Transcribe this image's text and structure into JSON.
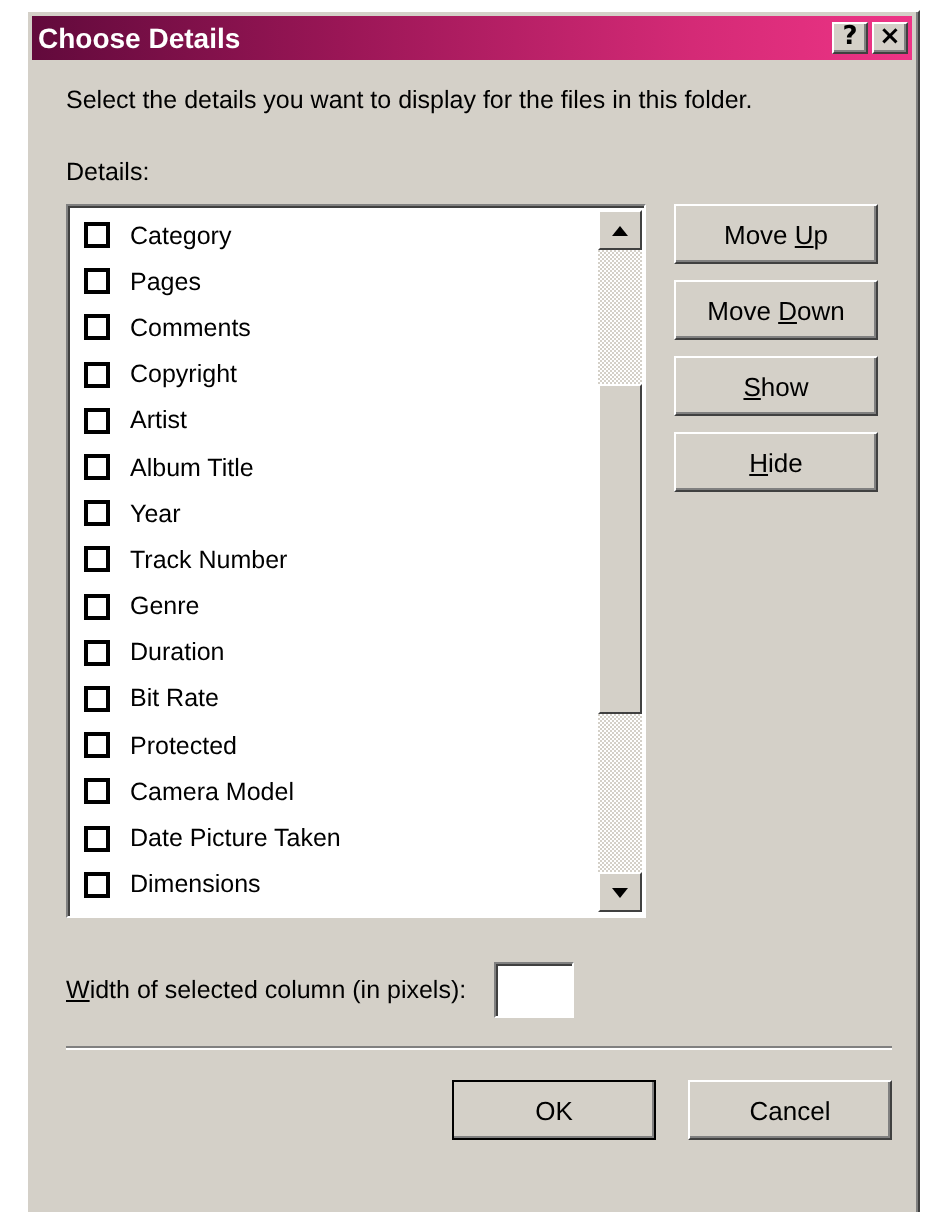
{
  "window": {
    "title": "Choose Details",
    "title_buttons": [
      "?",
      "×"
    ]
  },
  "instruction": "Select the details you want to display for the files in this folder.",
  "details_label": "Details:",
  "details": [
    {
      "label": "Category",
      "checked": false
    },
    {
      "label": "Pages",
      "checked": false
    },
    {
      "label": "Comments",
      "checked": false
    },
    {
      "label": "Copyright",
      "checked": false
    },
    {
      "label": "Artist",
      "checked": false
    },
    {
      "label": "Album Title",
      "checked": false
    },
    {
      "label": "Year",
      "checked": false
    },
    {
      "label": "Track Number",
      "checked": false
    },
    {
      "label": "Genre",
      "checked": false
    },
    {
      "label": "Duration",
      "checked": false
    },
    {
      "label": "Bit Rate",
      "checked": false
    },
    {
      "label": "Protected",
      "checked": false
    },
    {
      "label": "Camera Model",
      "checked": false
    },
    {
      "label": "Date Picture Taken",
      "checked": false
    },
    {
      "label": "Dimensions",
      "checked": false
    }
  ],
  "side_buttons": [
    {
      "label_start": "Move ",
      "access_key": "U",
      "label_rest": "p"
    },
    {
      "label_start": "Move ",
      "access_key": "D",
      "label_rest": "own"
    },
    {
      "access_key": "S",
      "label_rest": "how"
    },
    {
      "access_key": "H",
      "label_rest": "ide"
    }
  ],
  "width_field": {
    "access_key": "W",
    "label_rest": "idth of selected column (in pixels):"
  },
  "buttons": [
    {
      "label": "OK",
      "default": true
    },
    {
      "label": "Cancel",
      "default": false
    }
  ]
}
